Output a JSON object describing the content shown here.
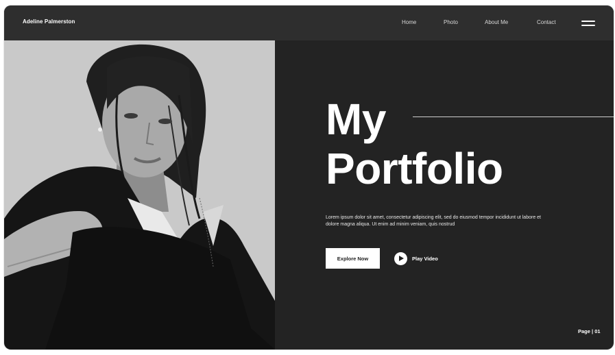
{
  "header": {
    "brand": "Adeline Palmerston",
    "nav": [
      "Home",
      "Photo",
      "About Me",
      "Contact"
    ],
    "menu_icon": "hamburger-menu-icon"
  },
  "hero": {
    "title_line1": "My",
    "title_line2": "Portfolio",
    "description": "Lorem ipsum dolor sit amet, consectetur adipiscing elit, sed do eiusmod tempor incididunt ut labore et dolore magna aliqua. Ut enim ad minim veniam, quis nostrud",
    "explore_label": "Explore Now",
    "play_label": "Play Video",
    "play_icon": "play-circle-icon"
  },
  "page_indicator": "Page | 01",
  "colors": {
    "background": "#232323",
    "header": "#2e2e2e",
    "accent": "#ffffff"
  }
}
